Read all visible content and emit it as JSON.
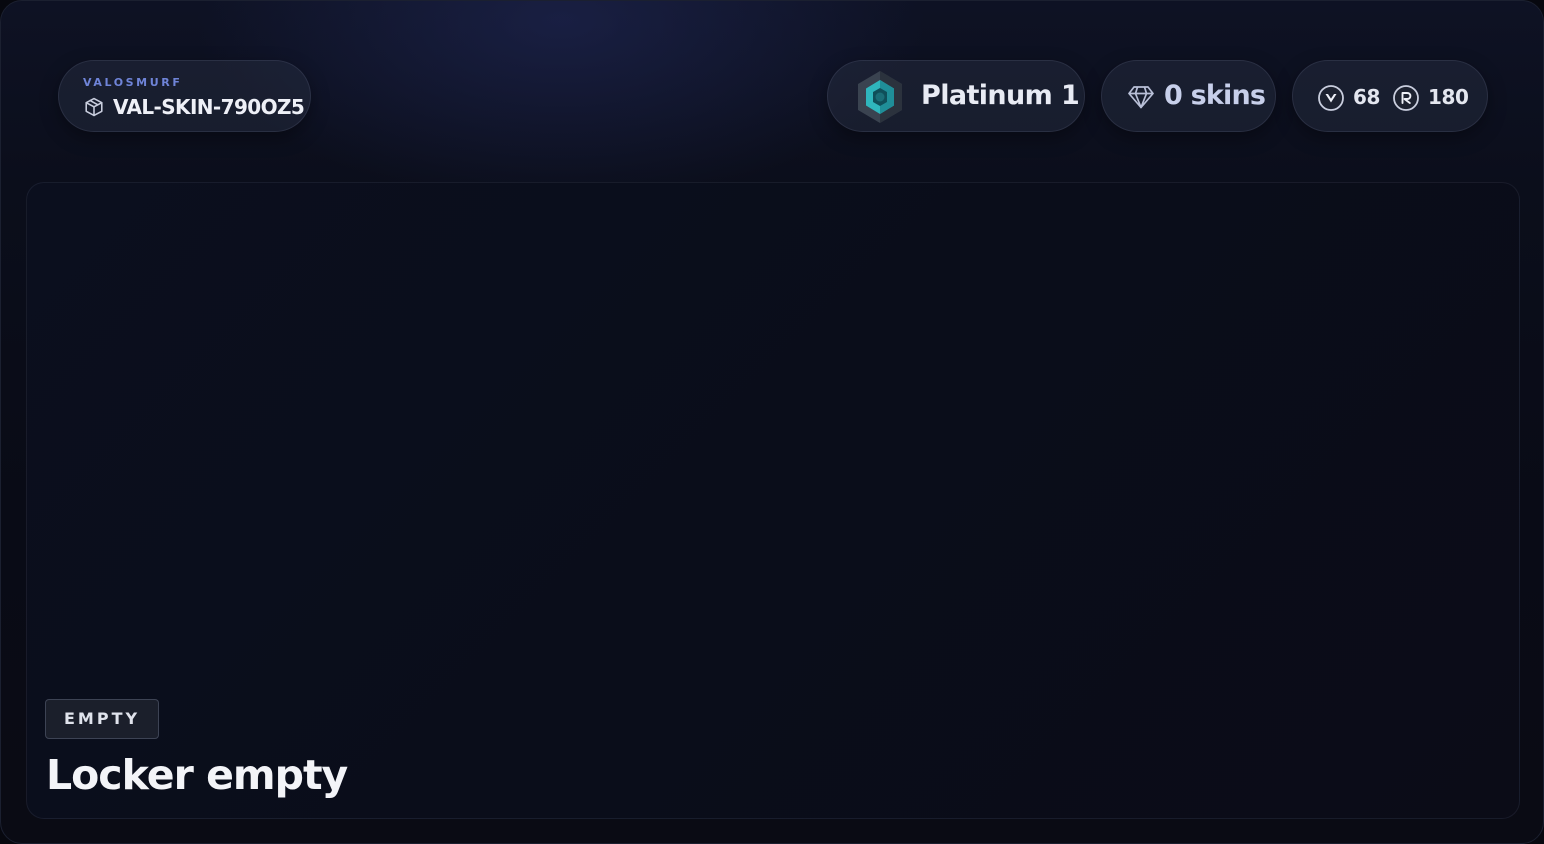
{
  "header": {
    "brand": "VALOSMURF",
    "account_id": "VAL-SKIN-790OZ5",
    "account_icon": "cube-icon",
    "rank": {
      "label": "Platinum 1",
      "icon": "platinum-rank-icon",
      "color": "#3fc6c9"
    },
    "skins": {
      "label": "0 skins",
      "icon": "gem-icon"
    },
    "currency": {
      "valorant_points": "68",
      "valorant_points_icon": "valorant-points-icon",
      "radianite_points": "180",
      "radianite_points_icon": "radianite-points-icon"
    }
  },
  "locker": {
    "badge": "EMPTY",
    "title": "Locker empty"
  },
  "colors": {
    "background": "#090b16",
    "brand_accent": "#6f84d8",
    "rank_accent": "#3fc6c9"
  }
}
